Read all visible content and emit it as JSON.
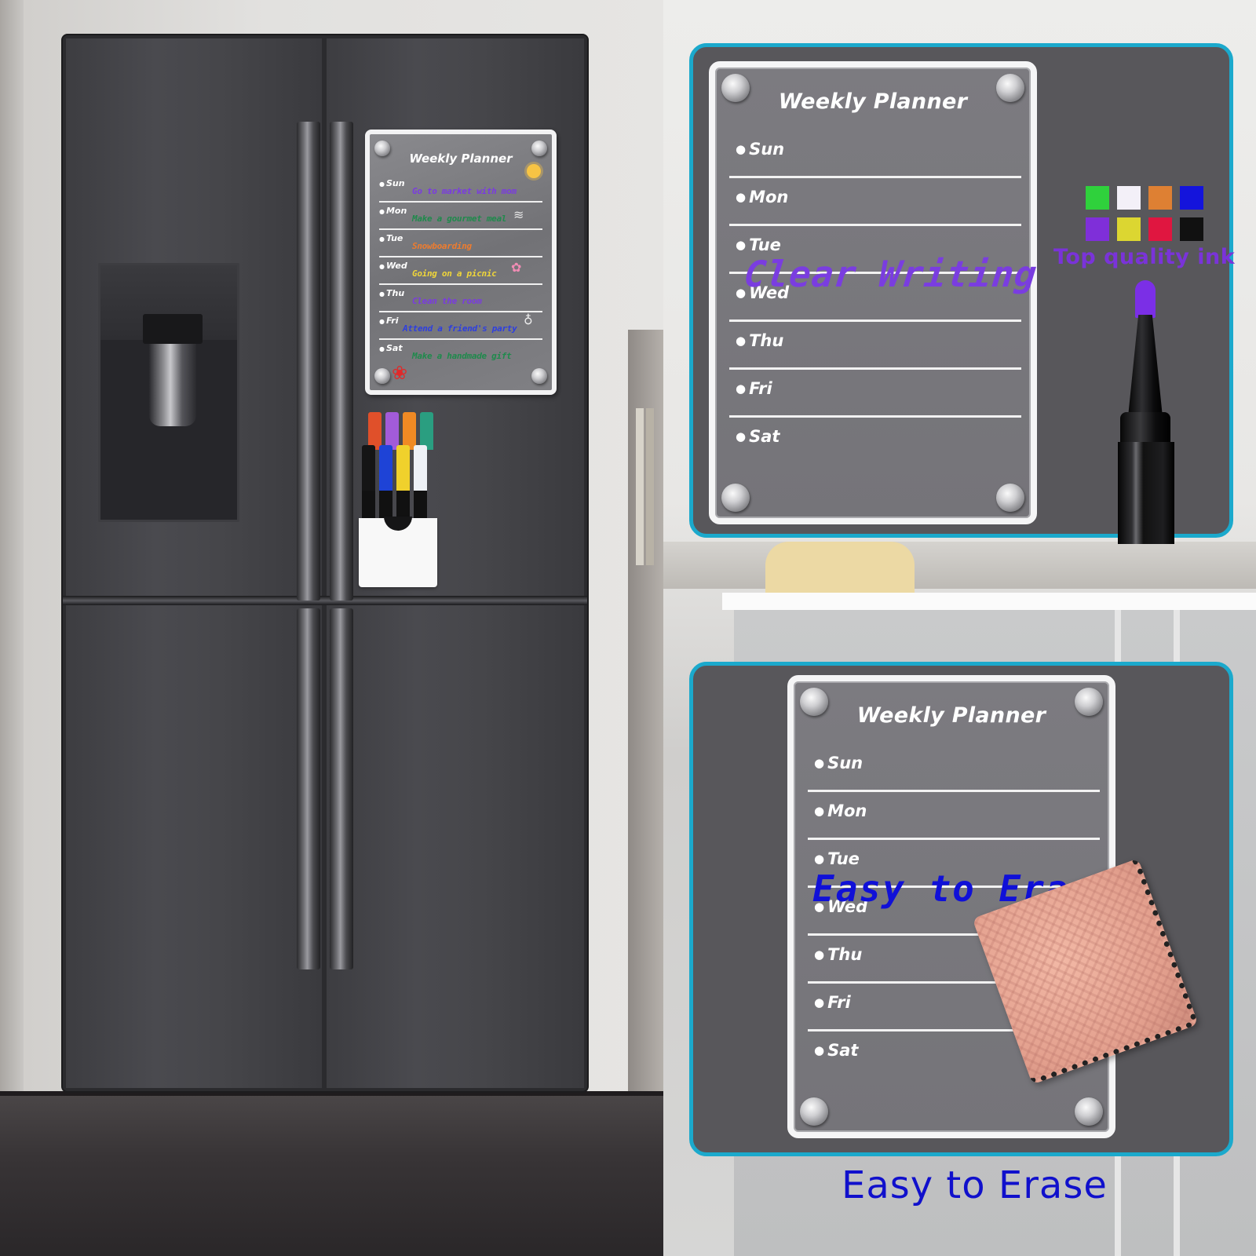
{
  "left_scene": {
    "subject": "refrigerator",
    "mini_planner": {
      "title": "Weekly Planner",
      "rows": [
        {
          "day": "Sun",
          "task": "Go to market with mom",
          "task_color": "#7a3be0",
          "doodle": "sun-icon"
        },
        {
          "day": "Mon",
          "task": "Make a gourmet meal",
          "task_color": "#1f8a4c",
          "doodle": "burger-icon"
        },
        {
          "day": "Tue",
          "task": "Snowboarding",
          "task_color": "#ee7c2f",
          "doodle": ""
        },
        {
          "day": "Wed",
          "task": "Going on a picnic",
          "task_color": "#f0d63a",
          "doodle": "flower-icon"
        },
        {
          "day": "Thu",
          "task": "Clean the room",
          "task_color": "#7a3be0",
          "doodle": ""
        },
        {
          "day": "Fri",
          "task": "Attend a friend's party",
          "task_color": "#2d3ee0",
          "doodle": "wine-glass-icon"
        },
        {
          "day": "Sat",
          "task": "Make a handmade gift",
          "task_color": "#1f8a4c",
          "doodle": "red-flower-icon"
        }
      ]
    },
    "markers": {
      "top_row_colors": [
        "#e0502a",
        "#a25bd9",
        "#f08a24",
        "#2a9e80"
      ],
      "bottom_row_colors": [
        "#151515",
        "#1e43d6",
        "#f0d12c",
        "#eef1f6"
      ]
    }
  },
  "panel_top": {
    "border_color": "#1ba9cc",
    "planner": {
      "title": "Weekly Planner",
      "days": [
        "Sun",
        "Mon",
        "Tue",
        "Wed",
        "Thu",
        "Fri",
        "Sat"
      ]
    },
    "overlay_text": "Clear Writing",
    "overlay_color": "#7a3de0",
    "swatches": [
      "#2fd13c",
      "#f3f0f8",
      "#de8033",
      "#1414dc",
      "#7f2fd9",
      "#dcd631",
      "#e01640",
      "#111111"
    ],
    "ink_label": "Top quality ink",
    "pen_tip_color": "#7b2fe6"
  },
  "panel_bottom": {
    "border_color": "#1ba9cc",
    "planner": {
      "title": "Weekly Planner",
      "days": [
        "Sun",
        "Mon",
        "Tue",
        "Wed",
        "Thu",
        "Fri",
        "Sat"
      ]
    },
    "overlay_text": "Easy to Erase",
    "overlay_color": "#1010d8"
  },
  "caption": "Easy to Erase"
}
